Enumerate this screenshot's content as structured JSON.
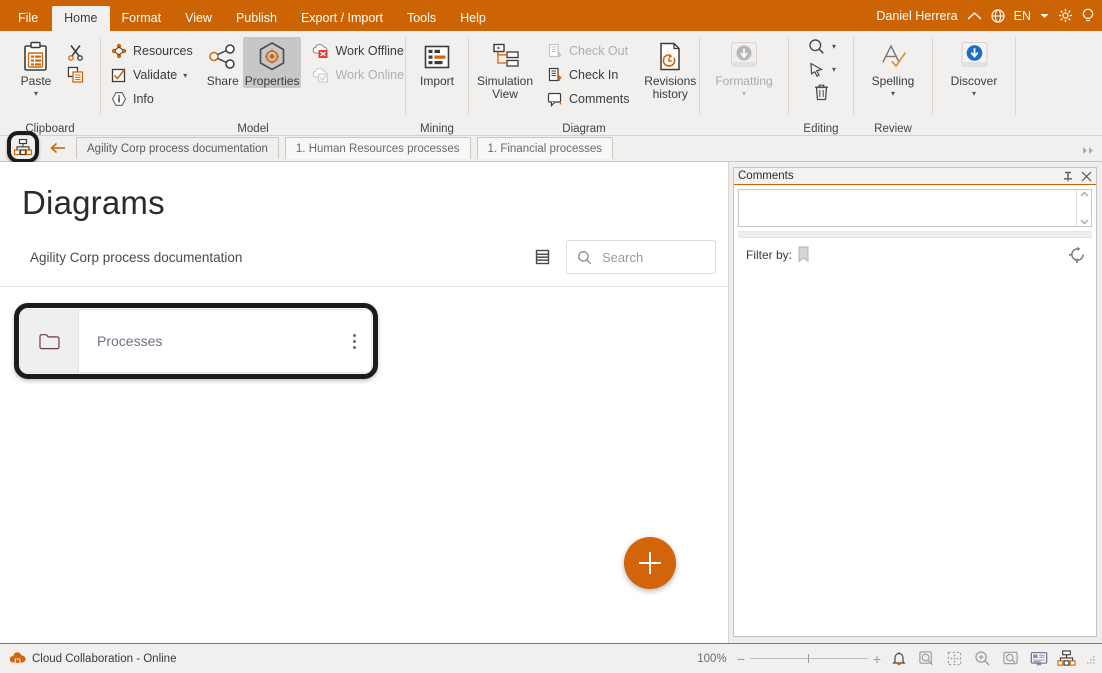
{
  "menu": {
    "items": [
      {
        "label": "File",
        "active": false
      },
      {
        "label": "Home",
        "active": true
      },
      {
        "label": "Format",
        "active": false
      },
      {
        "label": "View",
        "active": false
      },
      {
        "label": "Publish",
        "active": false
      },
      {
        "label": "Export / Import",
        "active": false
      },
      {
        "label": "Tools",
        "active": false
      },
      {
        "label": "Help",
        "active": false
      }
    ],
    "user": "Daniel Herrera",
    "collapse_icon": "chevron-up-icon",
    "language": "EN",
    "language_icon": "globe-icon",
    "settings_icon": "gear-icon",
    "help_icon": "lightbulb-icon"
  },
  "ribbon": {
    "groups": [
      {
        "label": "Clipboard",
        "big": [
          {
            "label": "Paste",
            "icon": "paste-icon",
            "caret": true
          }
        ],
        "small": [
          {
            "label": "",
            "icon": "cut-icon"
          },
          {
            "label": "",
            "icon": "copy-icon"
          }
        ]
      },
      {
        "label": "Model",
        "small": [
          {
            "label": "Resources",
            "icon": "resources-icon",
            "disabled": false
          },
          {
            "label": "Validate",
            "icon": "validate-icon",
            "disabled": false,
            "caret": true
          },
          {
            "label": "Info",
            "icon": "info-icon",
            "disabled": false
          }
        ],
        "big": [
          {
            "label": "Share",
            "icon": "share-icon"
          },
          {
            "label": "Properties",
            "icon": "properties-gear-icon",
            "selected": true
          }
        ],
        "small2": [
          {
            "label": "Work Offline",
            "icon": "work-offline-icon",
            "disabled": false
          },
          {
            "label": "Work Online",
            "icon": "work-online-icon",
            "disabled": true
          }
        ]
      },
      {
        "label": "Mining",
        "big": [
          {
            "label": "Import",
            "icon": "import-icon"
          }
        ]
      },
      {
        "label": "Diagram",
        "big": [
          {
            "label": "Simulation\nView",
            "icon": "simulation-view-icon"
          },
          {
            "label": "Revisions\nhistory",
            "icon": "revisions-history-icon"
          }
        ],
        "small": [
          {
            "label": "Check Out",
            "icon": "check-out-icon",
            "disabled": true
          },
          {
            "label": "Check In",
            "icon": "check-in-icon",
            "disabled": false
          },
          {
            "label": "Comments",
            "icon": "comments-icon",
            "disabled": false
          }
        ]
      },
      {
        "label": "",
        "big": [
          {
            "label": "Formatting",
            "icon": "formatting-icon",
            "caret": true,
            "disabled": true
          }
        ]
      },
      {
        "label": "Editing",
        "icons": [
          {
            "icon": "search-icon",
            "caret": true
          },
          {
            "icon": "pointer-icon",
            "caret": true
          },
          {
            "icon": "trash-icon",
            "caret": false
          }
        ]
      },
      {
        "label": "Review",
        "big": [
          {
            "label": "Spelling",
            "icon": "spelling-icon",
            "caret": true
          }
        ]
      },
      {
        "label": "",
        "big": [
          {
            "label": "Discover",
            "icon": "discover-icon",
            "caret": true
          }
        ]
      }
    ]
  },
  "tabstrip": {
    "hierarchy_icon": "hierarchy-icon",
    "back_icon": "arrow-left-icon",
    "tabs": [
      {
        "label": "Agility Corp process documentation",
        "active": true
      },
      {
        "label": "1. Human Resources processes",
        "active": false
      },
      {
        "label": "1. Financial processes",
        "active": false
      }
    ],
    "overflow_icon": "double-chevron-right-icon"
  },
  "main": {
    "page_title": "Diagrams",
    "breadcrumb": "Agility Corp process documentation",
    "list_view_icon": "list-view-icon",
    "search": {
      "placeholder": "Search",
      "value": "",
      "icon": "search-icon"
    },
    "folders": [
      {
        "name": "Processes",
        "icon": "folder-icon",
        "menu_icon": "kebab-menu-icon",
        "highlighted": true
      }
    ],
    "add_button": {
      "icon": "plus-icon",
      "label": ""
    }
  },
  "comments": {
    "title": "Comments",
    "pin_icon": "pin-icon",
    "close_icon": "close-icon",
    "input_value": "",
    "scroll_up_icon": "chevron-up-icon",
    "scroll_down_icon": "chevron-down-icon",
    "filter_label": "Filter by:",
    "filter_icon": "bookmark-icon",
    "refresh_icon": "refresh-icon"
  },
  "statusbar": {
    "cloud_icon": "cloud-collab-icon",
    "status_text": "Cloud Collaboration - Online",
    "zoom_percent": "100%",
    "zoom_out_icon": "minus-icon",
    "zoom_in_icon": "plus-icon",
    "icons": [
      {
        "icon": "bell-icon"
      },
      {
        "icon": "fit-page-icon"
      },
      {
        "icon": "fit-selection-icon"
      },
      {
        "icon": "zoom-in-magnifier-icon"
      },
      {
        "icon": "zoom-region-icon"
      },
      {
        "icon": "presentation-icon"
      },
      {
        "icon": "hierarchy-icon"
      }
    ],
    "resize_grip_icon": "resize-grip-icon"
  },
  "colors": {
    "accent": "#cc6406",
    "ribbon_bg": "#f1f0ef",
    "panel_bg": "#eeeeee",
    "fab": "#d2640a",
    "folder_icon": "#6b3a52"
  }
}
